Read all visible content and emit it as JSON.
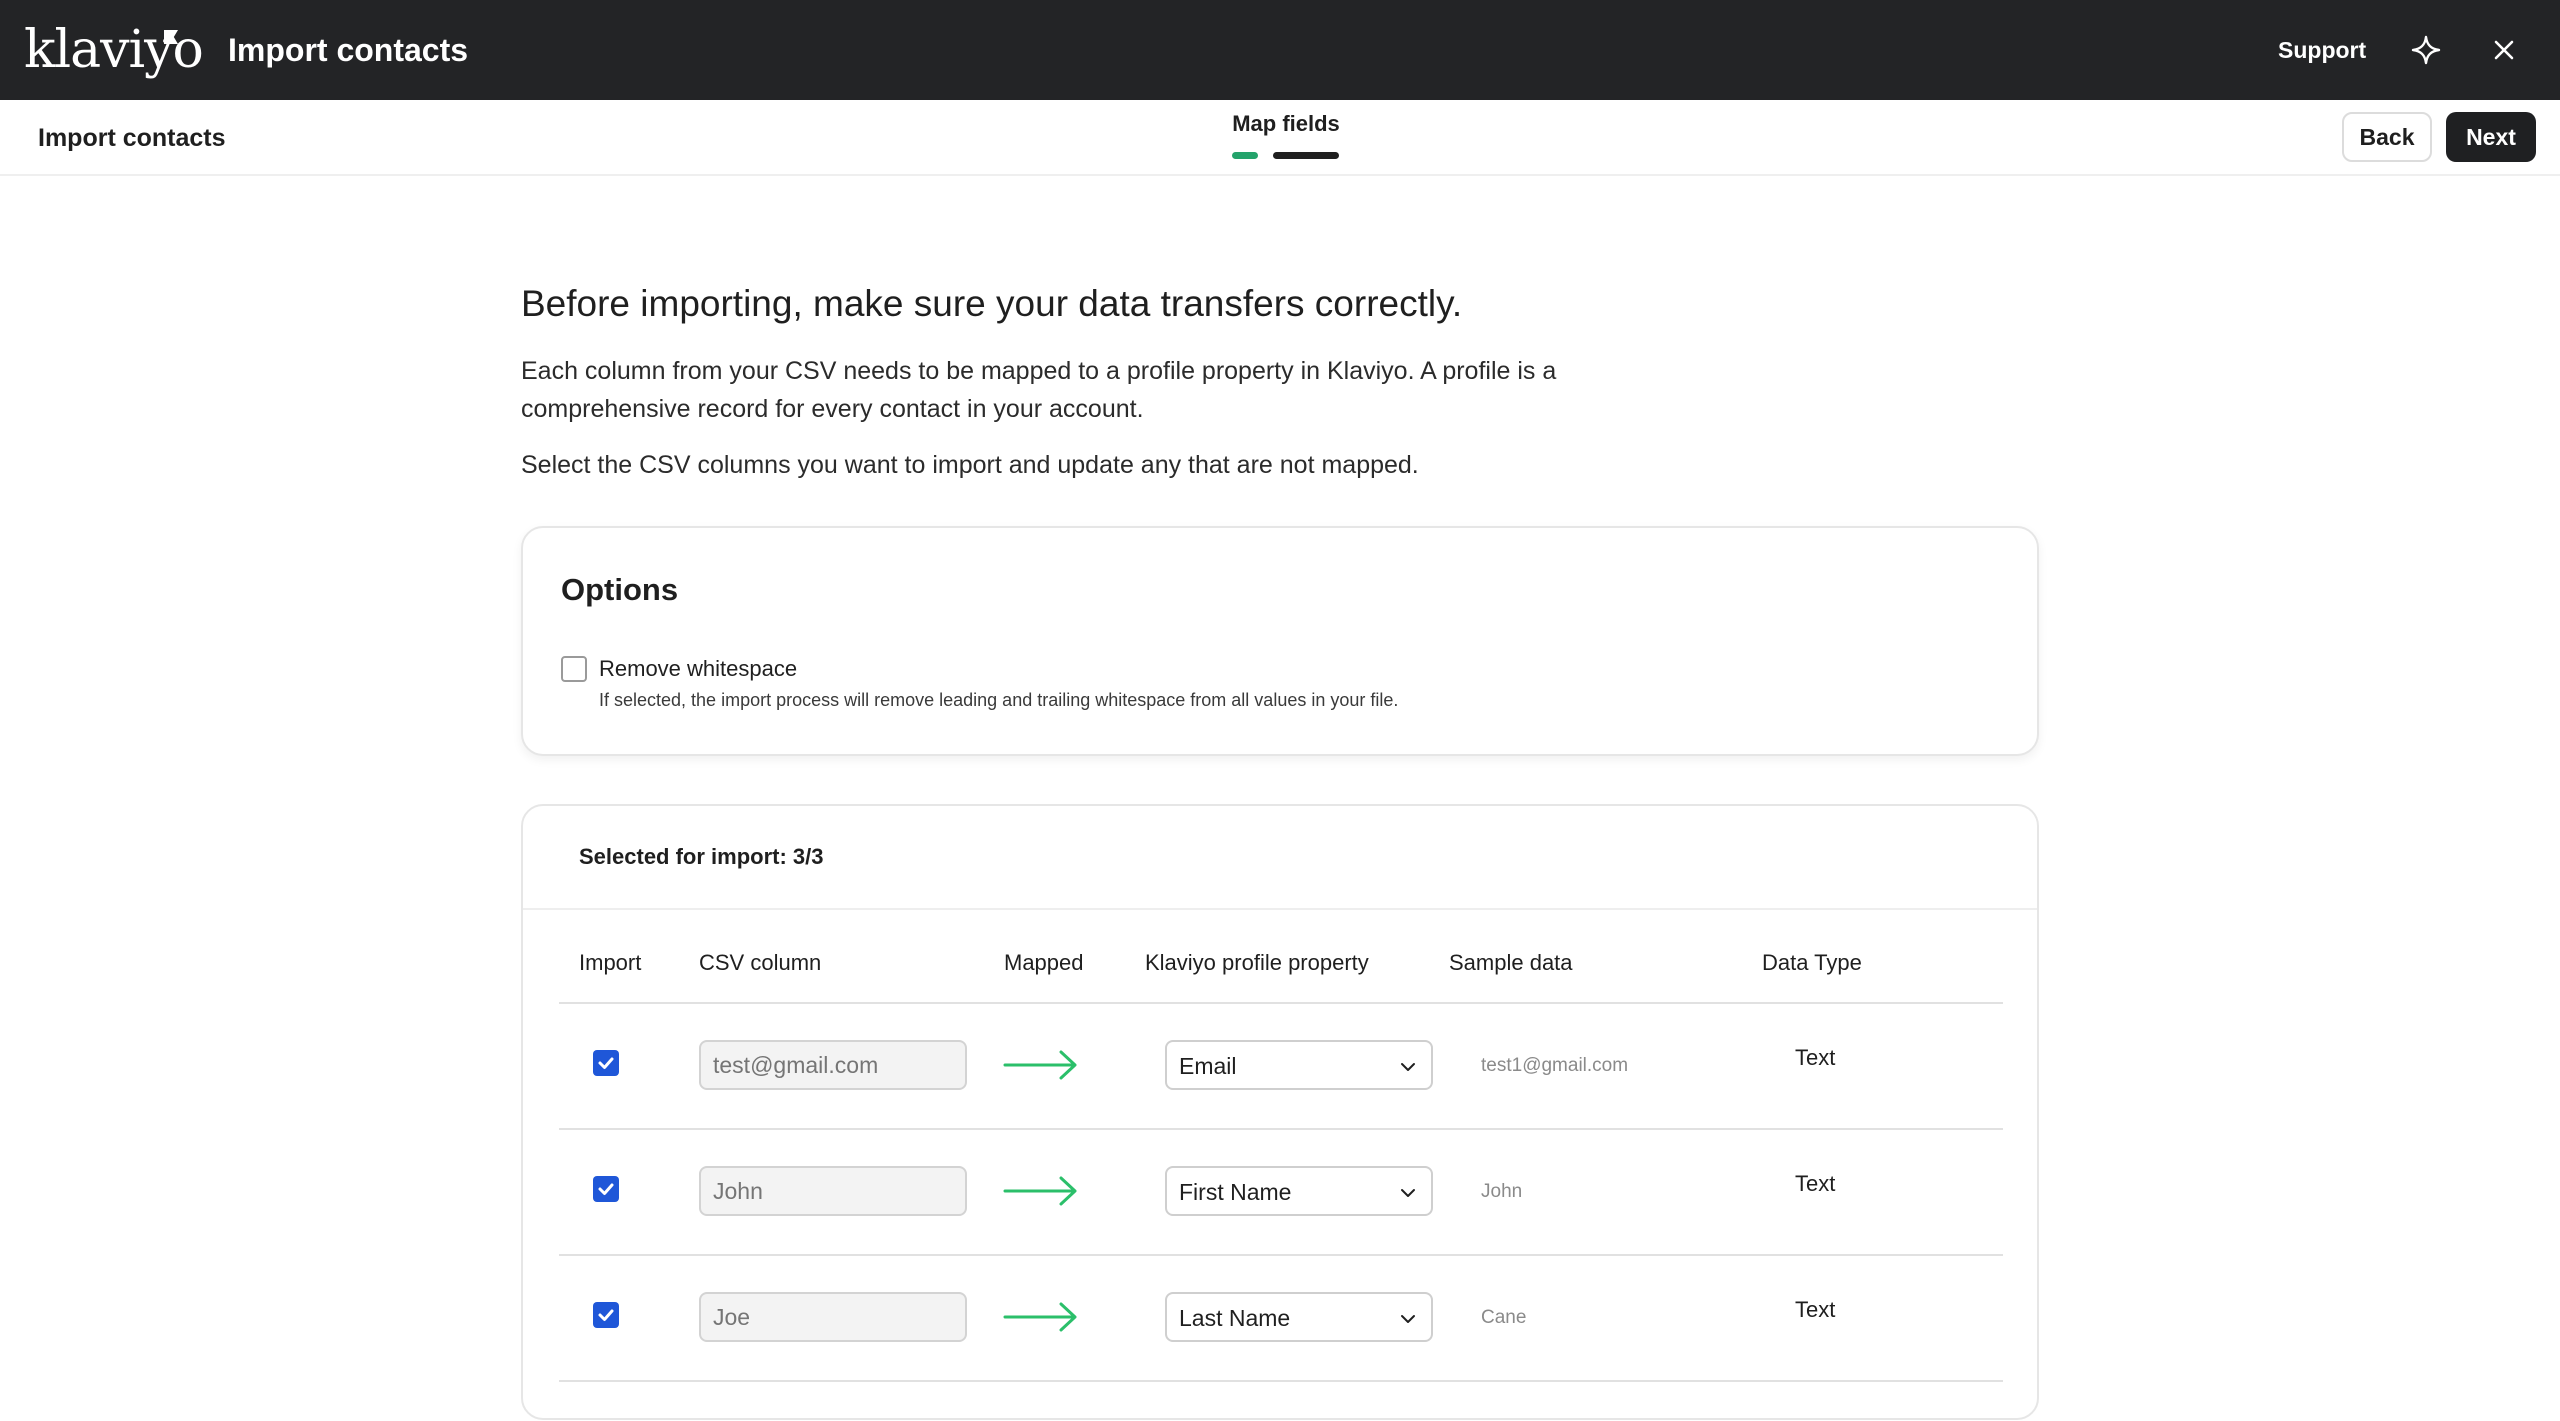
{
  "topbar": {
    "logo_text": "klaviyo",
    "title": "Import contacts",
    "support_label": "Support"
  },
  "subheader": {
    "title": "Import contacts",
    "step_label": "Map fields",
    "back_label": "Back",
    "next_label": "Next",
    "colors": {
      "progress_done": "#24a36b",
      "progress_current": "#1f1f1f"
    }
  },
  "main": {
    "heading": "Before importing, make sure your data transfers correctly.",
    "paragraph1": "Each column from your CSV needs to be mapped to a profile property in Klaviyo. A profile is a comprehensive record for every contact in your account.",
    "paragraph2": "Select the CSV columns you want to import and update any that are not mapped."
  },
  "options": {
    "title": "Options",
    "remove_whitespace_label": "Remove whitespace",
    "remove_whitespace_help": "If selected, the import process will remove leading and trailing whitespace from all values in your file.",
    "remove_whitespace_checked": false
  },
  "import_table": {
    "selected_label": "Selected for import: 3/3",
    "headers": {
      "import": "Import",
      "csv_column": "CSV column",
      "mapped": "Mapped",
      "property": "Klaviyo profile property",
      "sample": "Sample data",
      "data_type": "Data Type"
    },
    "rows": [
      {
        "checked": true,
        "csv_placeholder": "test@gmail.com",
        "property": "Email",
        "sample": "test1@gmail.com",
        "data_type": "Text"
      },
      {
        "checked": true,
        "csv_placeholder": "John",
        "property": "First Name",
        "sample": "John",
        "data_type": "Text"
      },
      {
        "checked": true,
        "csv_placeholder": "Joe",
        "property": "Last Name",
        "sample": "Cane",
        "data_type": "Text"
      }
    ],
    "colors": {
      "checkbox": "#1f57d8",
      "arrow": "#2bbf6a"
    }
  }
}
